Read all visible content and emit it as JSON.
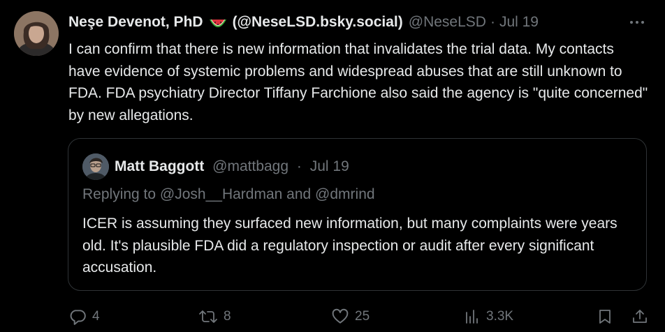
{
  "post": {
    "author": {
      "display_name": "Neşe Devenot, PhD",
      "emoji_icon": "watermelon-icon",
      "alt_handle": "(@NeseLSD.bsky.social)",
      "handle": "@NeseLSD",
      "separator": "·",
      "date": "Jul 19"
    },
    "text": "I can confirm that there is new information that invalidates the trial data. My contacts have evidence of systemic problems and widespread abuses that are still unknown to FDA. FDA psychiatry Director Tiffany Farchione also said the agency is \"quite concerned\" by new allegations.",
    "more_icon": "more-dots-icon"
  },
  "quote": {
    "author": {
      "display_name": "Matt Baggott",
      "handle": "@mattbagg",
      "separator": "·",
      "date": "Jul 19"
    },
    "reply_prefix": "Replying to",
    "reply_to_1": "@Josh__Hardman",
    "reply_and": "and",
    "reply_to_2": "@dmrind",
    "text": "ICER is assuming they surfaced new information, but many complaints were years old. It's plausible FDA did a regulatory inspection or audit after every significant accusation."
  },
  "actions": {
    "replies": "4",
    "reposts": "8",
    "likes": "25",
    "views": "3.3K"
  },
  "colors": {
    "background": "#000000",
    "text": "#e7e9ea",
    "muted": "#71767b",
    "border": "#2f3336"
  }
}
